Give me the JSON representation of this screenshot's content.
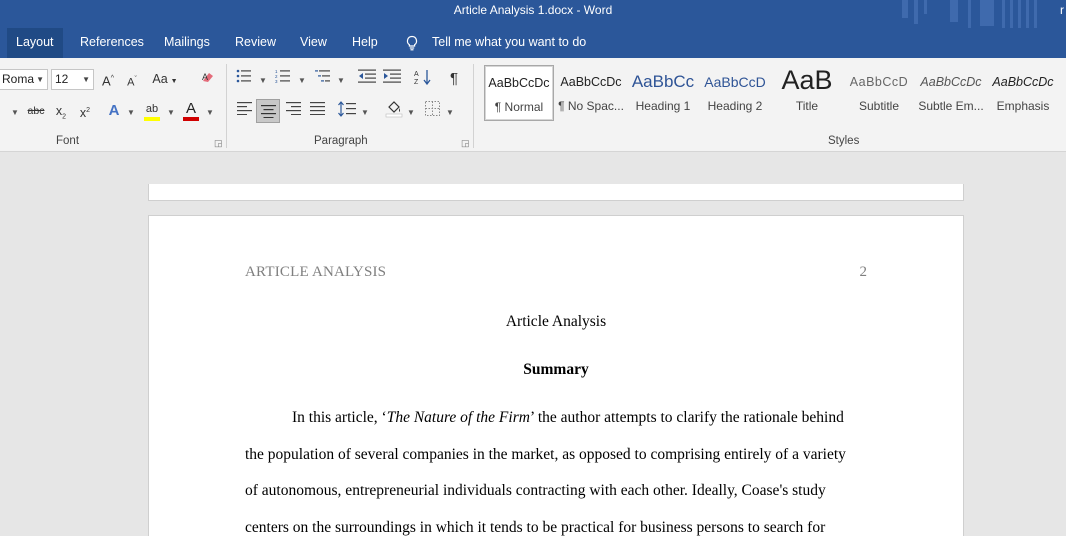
{
  "window": {
    "title": "Article Analysis 1.docx  -  Word",
    "corner_text": "r"
  },
  "tabs": [
    {
      "label": "Layout",
      "active": true
    },
    {
      "label": "References"
    },
    {
      "label": "Mailings"
    },
    {
      "label": "Review"
    },
    {
      "label": "View"
    },
    {
      "label": "Help"
    }
  ],
  "tell_me": "Tell me what you want to do",
  "ribbon": {
    "font": {
      "name": "Roma",
      "size": "12",
      "group_label": "Font",
      "grow_label": "A",
      "shrink_label": "A",
      "case_label": "Aa",
      "strike_label": "abc",
      "sub_label": "x",
      "super_label": "x",
      "effects_label": "A",
      "font_color_label": "A",
      "highlight_label": "ab"
    },
    "paragraph": {
      "group_label": "Paragraph",
      "pilcrow": "¶"
    },
    "styles": {
      "group_label": "Styles",
      "items": [
        {
          "sample": "AaBbCcDc",
          "name": "¶ Normal"
        },
        {
          "sample": "AaBbCcDc",
          "name": "¶ No Spac..."
        },
        {
          "sample": "AaBbCc",
          "name": "Heading 1"
        },
        {
          "sample": "AaBbCcD",
          "name": "Heading 2"
        },
        {
          "sample": "AaB",
          "name": "Title"
        },
        {
          "sample": "AaBbCcD",
          "name": "Subtitle"
        },
        {
          "sample": "AaBbCcDc",
          "name": "Subtle Em..."
        },
        {
          "sample": "AaBbCcDc",
          "name": "Emphasis"
        }
      ]
    }
  },
  "document": {
    "running_head": "ARTICLE ANALYSIS",
    "page_number": "2",
    "title": "Article Analysis",
    "summary_heading": "Summary",
    "line1_prefix": "In this article, ‘",
    "line1_italic": "The Nature of the Firm",
    "line1_suffix": "’ the author attempts to clarify the rationale behind",
    "lines": [
      "the population of several companies in the market, as opposed to comprising entirely of a variety",
      "of autonomous, entrepreneurial individuals contracting with each other. Ideally, Coase's study",
      "centers on the surroundings in which it tends to be practical for business persons to search for"
    ]
  }
}
